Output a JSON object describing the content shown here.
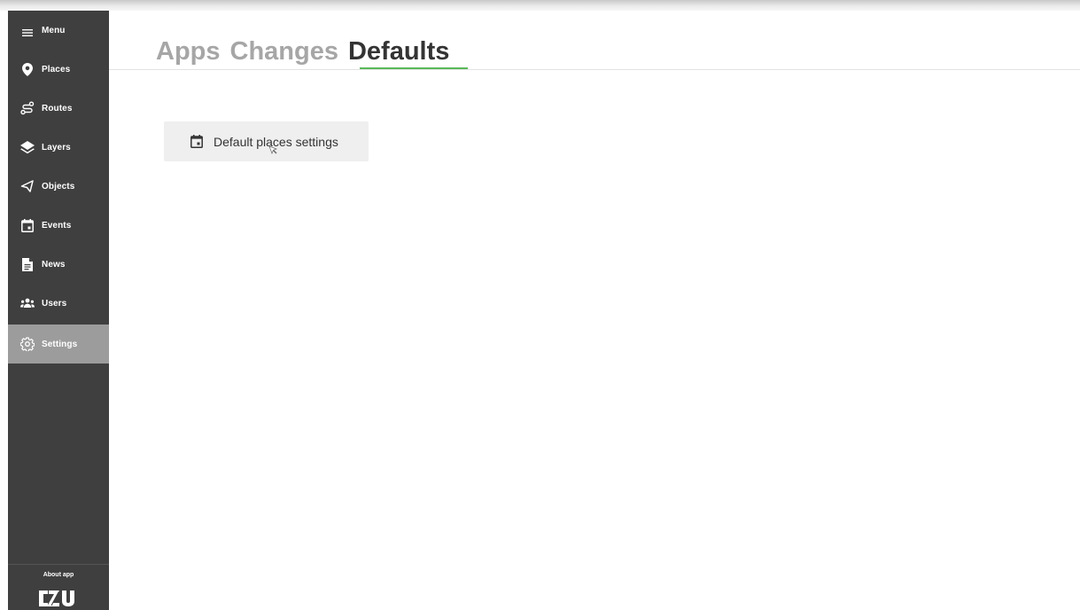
{
  "sidebar": {
    "menu_label": "Menu",
    "items": [
      {
        "label": "Places",
        "icon": "map-pin-icon"
      },
      {
        "label": "Routes",
        "icon": "route-icon"
      },
      {
        "label": "Layers",
        "icon": "layers-icon"
      },
      {
        "label": "Objects",
        "icon": "objects-icon"
      },
      {
        "label": "Events",
        "icon": "calendar-icon"
      },
      {
        "label": "News",
        "icon": "document-icon"
      },
      {
        "label": "Users",
        "icon": "users-icon"
      },
      {
        "label": "Settings",
        "icon": "gear-icon",
        "active": true
      }
    ],
    "about_label": "About app",
    "logo_text": "CZU"
  },
  "tabs": [
    {
      "label": "Apps",
      "active": false
    },
    {
      "label": "Changes",
      "active": false
    },
    {
      "label": "Defaults",
      "active": true
    }
  ],
  "main": {
    "button_label": "Default places settings",
    "button_icon": "calendar-icon"
  },
  "colors": {
    "sidebar_bg": "#3f3f3f",
    "active_item_bg": "#9c9c9c",
    "tab_accent": "#5bb85b",
    "inactive_tab": "#a6a6a6"
  }
}
